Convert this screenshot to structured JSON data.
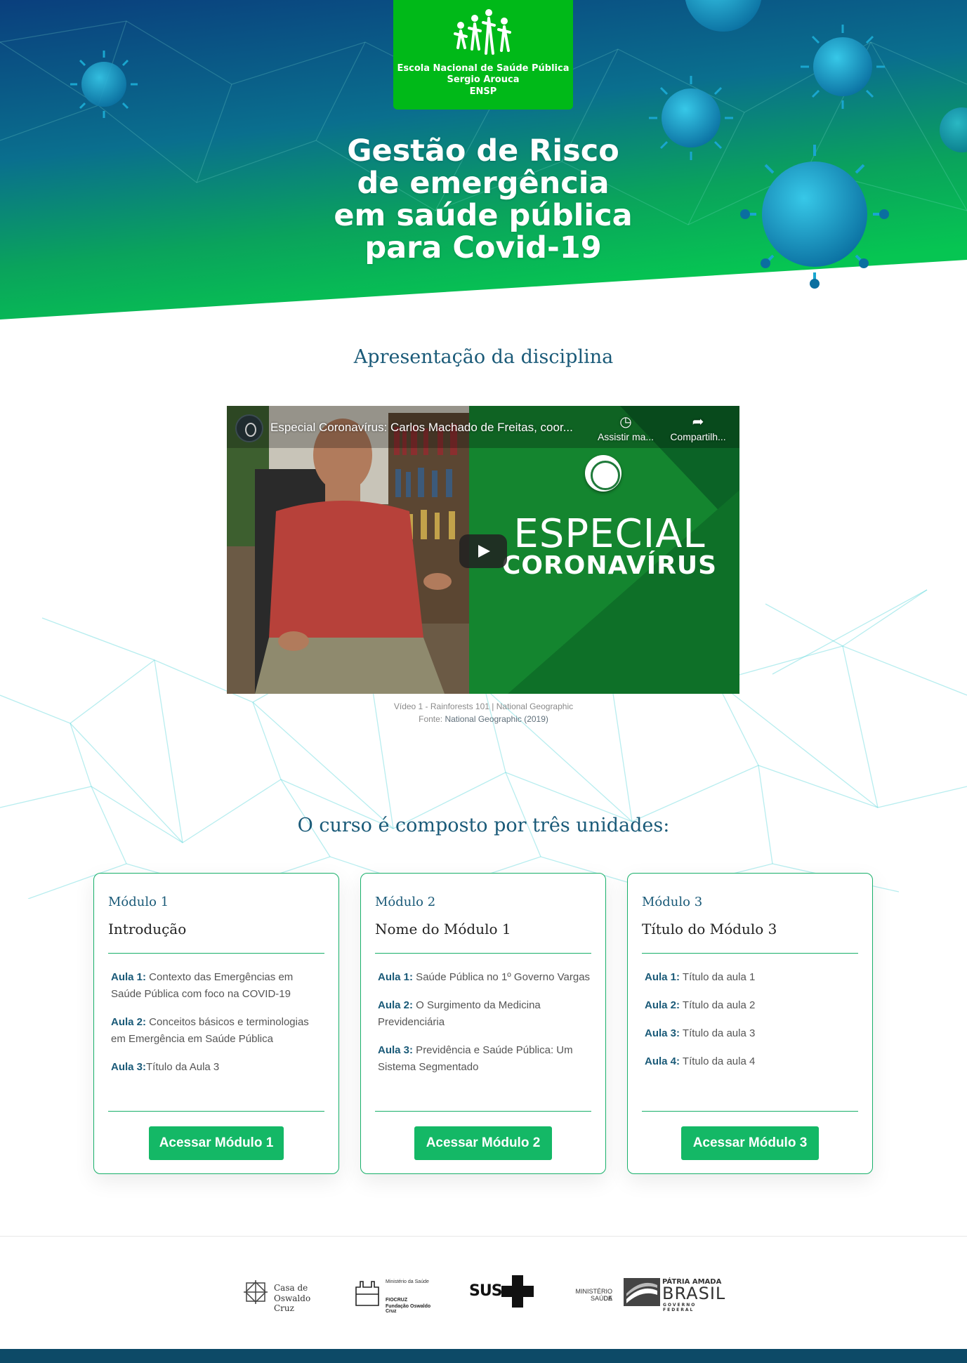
{
  "hero": {
    "logo": {
      "line1": "Escola Nacional de Saúde Pública",
      "line2": "Sergio Arouca",
      "line3": "ENSP"
    },
    "title_lines": [
      "Gestão de Risco",
      "de emergência",
      "em saúde pública",
      "para Covid-19"
    ]
  },
  "presentation": {
    "heading": "Apresentação da disciplina",
    "video": {
      "title": "Especial Coronavírus: Carlos Machado de Freitas, coor...",
      "watch_later": "Assistir ma...",
      "share": "Compartilh...",
      "overlay_line1": "ESPECIAL",
      "overlay_line2": "CORONAVÍRUS"
    },
    "caption_line1": "Vídeo 1 - Rainforests 101 | National Geographic",
    "caption_source_label": "Fonte: ",
    "caption_source": "National Geographic (2019)"
  },
  "course": {
    "heading": "O curso é composto por três unidades:",
    "modules": [
      {
        "number": "Módulo 1",
        "name": "Introdução",
        "lessons": [
          {
            "label": "Aula 1:",
            "title": " Contexto das Emergências em Saúde Pública com foco na COVID-19"
          },
          {
            "label": "Aula 2:",
            "title": " Conceitos básicos e terminologias em Emergência em Saúde Pública"
          },
          {
            "label": "Aula 3:",
            "title": "Título da Aula 3"
          }
        ],
        "button": "Acessar Módulo 1"
      },
      {
        "number": "Módulo 2",
        "name": "Nome do Módulo 1",
        "lessons": [
          {
            "label": "Aula 1:",
            "title": " Saúde Pública no 1º Governo Vargas"
          },
          {
            "label": "Aula 2:",
            "title": " O Surgimento da Medicina Previdenciária"
          },
          {
            "label": "Aula 3:",
            "title": " Previdência e Saúde Pública: Um Sistema Segmentado"
          }
        ],
        "button": "Acessar Módulo 2"
      },
      {
        "number": "Módulo 3",
        "name": "Título do Módulo 3",
        "lessons": [
          {
            "label": "Aula 1:",
            "title": " Título da aula 1"
          },
          {
            "label": "Aula 2:",
            "title": " Título da aula 2"
          },
          {
            "label": "Aula 3:",
            "title": " Título da aula 3"
          },
          {
            "label": "Aula 4:",
            "title": " Título da aula 4"
          }
        ],
        "button": "Acessar Módulo 3"
      }
    ]
  },
  "footer": {
    "partners": {
      "casa_line1": "Casa de",
      "casa_line2": "Oswaldo Cruz",
      "ms_small": "Ministério da Saúde",
      "fiocruz_line1": "FIOCRUZ",
      "fiocruz_line2": "Fundação Oswaldo Cruz",
      "sus": "SUS",
      "ministerio_line1": "MINISTÉRIO DA",
      "ministerio_line2": "SAÚDE",
      "patria": "PÁTRIA AMADA",
      "brasil": "BRASIL",
      "governo": "GOVERNO FEDERAL"
    }
  },
  "colors": {
    "hero_blue": "#0a4f8a",
    "hero_green": "#07b84f",
    "logo_green": "#00b918",
    "heading_blue": "#1a5a78",
    "accent_green": "#14b866",
    "footer_bar": "#0d4a67"
  }
}
